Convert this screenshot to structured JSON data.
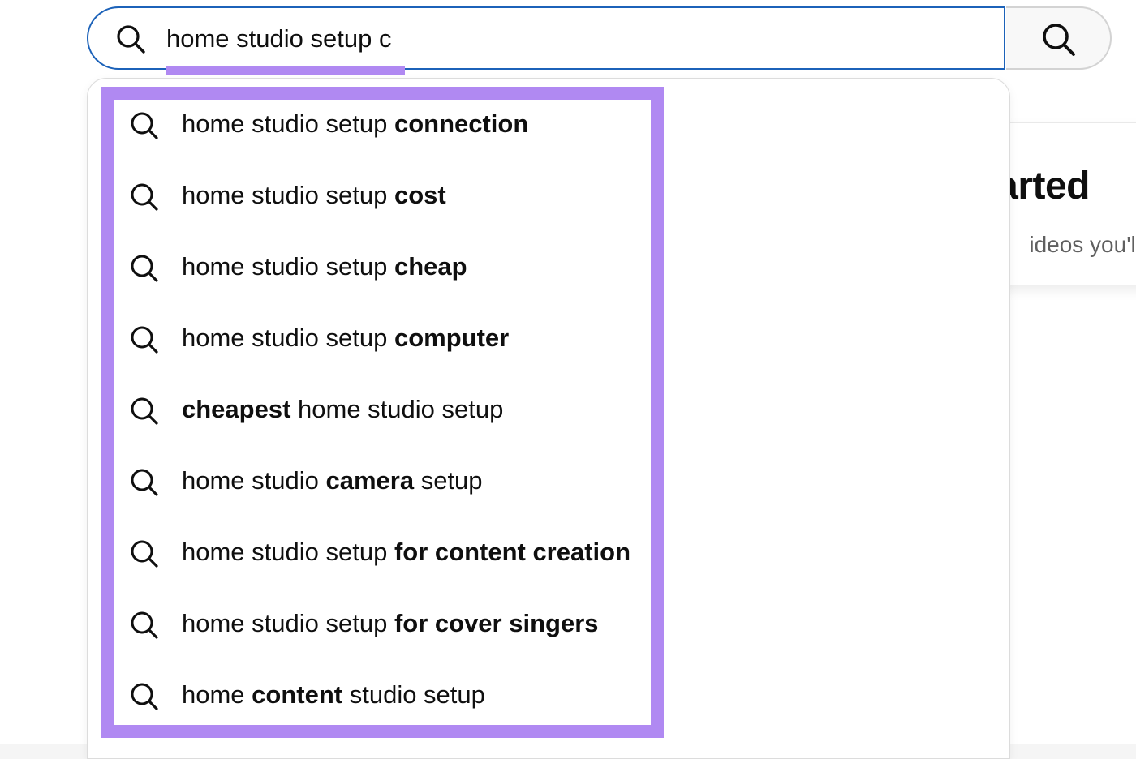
{
  "search": {
    "query": "home studio setup c",
    "clear_label": "clear-search",
    "submit_label": "search"
  },
  "background_card": {
    "title_fragment": "arted",
    "subtitle_fragment": "ideos you'll l"
  },
  "suggestions": [
    {
      "parts": [
        {
          "t": "home studio setup ",
          "b": false
        },
        {
          "t": "connection",
          "b": true
        }
      ]
    },
    {
      "parts": [
        {
          "t": "home studio setup ",
          "b": false
        },
        {
          "t": "cost",
          "b": true
        }
      ]
    },
    {
      "parts": [
        {
          "t": "home studio setup ",
          "b": false
        },
        {
          "t": "cheap",
          "b": true
        }
      ]
    },
    {
      "parts": [
        {
          "t": "home studio setup ",
          "b": false
        },
        {
          "t": "computer",
          "b": true
        }
      ]
    },
    {
      "parts": [
        {
          "t": "cheapest",
          "b": true
        },
        {
          "t": " home studio setup",
          "b": false
        }
      ]
    },
    {
      "parts": [
        {
          "t": "home studio ",
          "b": false
        },
        {
          "t": "camera",
          "b": true
        },
        {
          "t": " setup",
          "b": false
        }
      ]
    },
    {
      "parts": [
        {
          "t": "home studio setup ",
          "b": false
        },
        {
          "t": "for content creation",
          "b": true
        }
      ]
    },
    {
      "parts": [
        {
          "t": "home studio setup ",
          "b": false
        },
        {
          "t": "for cover singers",
          "b": true
        }
      ]
    },
    {
      "parts": [
        {
          "t": "home ",
          "b": false
        },
        {
          "t": "content",
          "b": true
        },
        {
          "t": " studio setup",
          "b": false
        }
      ]
    }
  ],
  "colors": {
    "highlight": "#b089f2",
    "focus_border": "#1c62b9",
    "text": "#0f0f0f"
  },
  "icons": {
    "search": "search-icon",
    "clear": "close-icon"
  }
}
